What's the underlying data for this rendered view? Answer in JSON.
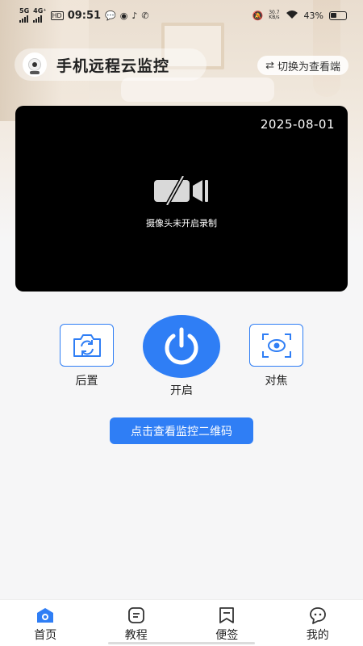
{
  "status_bar": {
    "signal_1": "5G",
    "signal_2": "4G⁺",
    "hd": "HD",
    "time": "09:51",
    "network_speed_value": "30.7",
    "network_speed_unit": "KB/s",
    "battery_percent": "43%"
  },
  "header": {
    "title": "手机远程云监控",
    "switch_label": "切换为查看端"
  },
  "preview": {
    "date": "2025-08-01",
    "message": "摄像头未开启录制"
  },
  "controls": {
    "rear_label": "后置",
    "power_label": "开启",
    "focus_label": "对焦"
  },
  "qr_button_label": "点击查看监控二维码",
  "bottom_nav": {
    "items": [
      {
        "label": "首页",
        "icon": "home-camera-icon"
      },
      {
        "label": "教程",
        "icon": "tutorial-icon"
      },
      {
        "label": "便签",
        "icon": "note-icon"
      },
      {
        "label": "我的",
        "icon": "profile-icon"
      }
    ]
  },
  "colors": {
    "accent": "#2f7ef5",
    "preview_bg": "#000000",
    "page_bg": "#f6f6f7"
  }
}
